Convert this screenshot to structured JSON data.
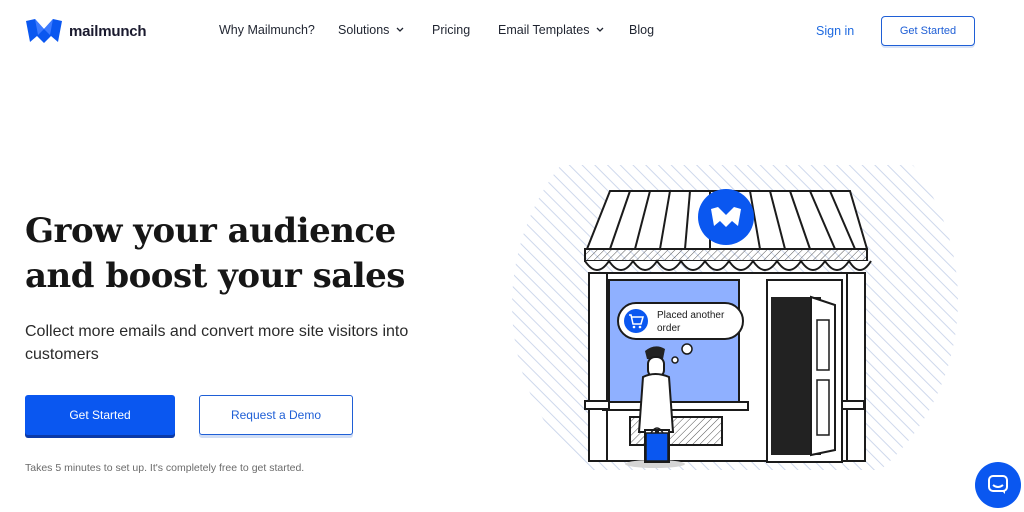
{
  "brand": {
    "name": "mailmunch",
    "color": "#0a57f0",
    "logo_icon": "mailmunch-logo-icon"
  },
  "nav": [
    {
      "label": "Why Mailmunch?",
      "dropdown": false
    },
    {
      "label": "Solutions",
      "dropdown": true
    },
    {
      "label": "Pricing",
      "dropdown": false
    },
    {
      "label": "Email Templates",
      "dropdown": true
    },
    {
      "label": "Blog",
      "dropdown": false
    }
  ],
  "header": {
    "signin_label": "Sign in",
    "cta_label": "Get Started"
  },
  "hero": {
    "headline_line1": "Grow your audience",
    "headline_line2": "and boost your sales",
    "subheadline": "Collect more emails and convert more site visitors into customers",
    "primary_cta": "Get Started",
    "secondary_cta": "Request a Demo",
    "fineprint": "Takes 5 minutes to set up. It's completely free to get started."
  },
  "illustration": {
    "bubble_text": "Placed another order",
    "icons": [
      "storefront-icon",
      "cart-icon",
      "shopping-bag-icon"
    ]
  },
  "chat": {
    "icon": "chat-icon"
  },
  "colors": {
    "accent": "#0a57f0",
    "text": "#161616",
    "link": "#1f6ae0",
    "window_blue": "#8fb0ff"
  }
}
